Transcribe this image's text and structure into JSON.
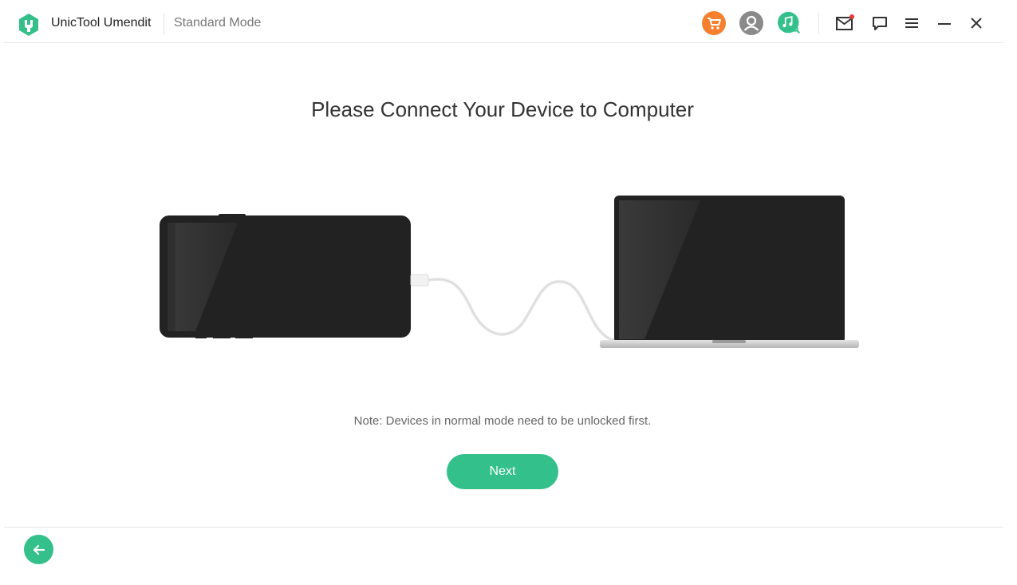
{
  "titlebar": {
    "app_name": "UnicTool Umendit",
    "mode": "Standard Mode",
    "icons": {
      "cart": "cart-icon",
      "account": "user-account-icon",
      "music": "music-search-icon",
      "mail": "mail-icon",
      "feedback": "chat-icon",
      "menu": "menu-icon",
      "minimize": "minimize-icon",
      "close": "close-icon"
    },
    "mail_has_notification": true
  },
  "colors": {
    "brand_green": "#33c08a",
    "cart_orange": "#f7802f",
    "account_gray": "#8a8a8a",
    "notification_red": "#e53935"
  },
  "main": {
    "title": "Please Connect Your Device to Computer",
    "note": "Note: Devices in normal mode need to be unlocked first.",
    "next_label": "Next"
  },
  "footer": {
    "back_icon": "arrow-left-icon"
  }
}
